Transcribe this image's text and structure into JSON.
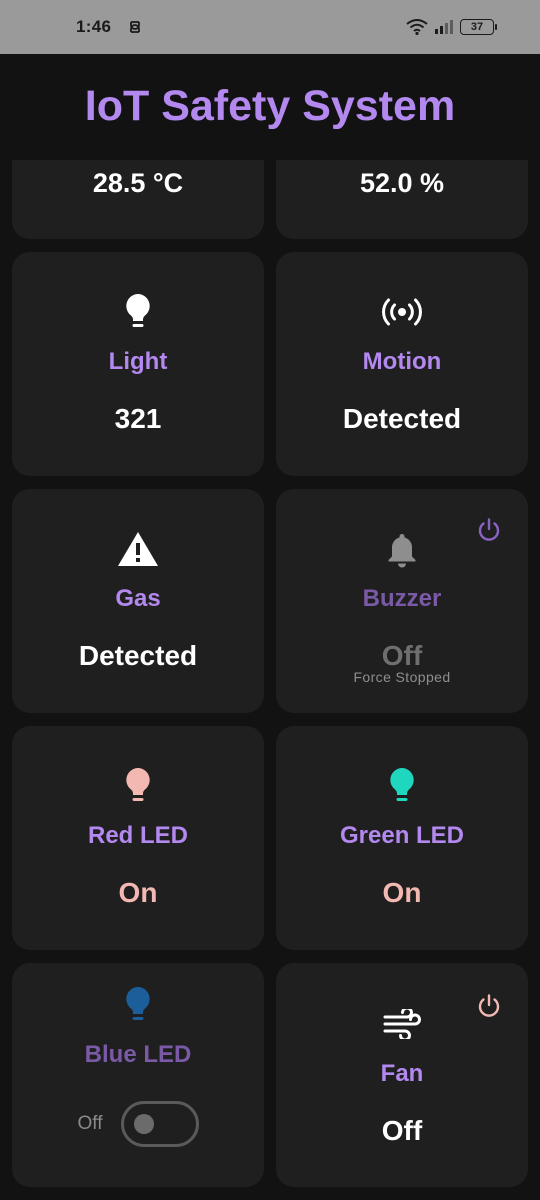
{
  "status_bar": {
    "time": "1:46",
    "battery": "37"
  },
  "app": {
    "title": "IoT Safety System"
  },
  "cards": {
    "temperature": {
      "value": "28.5 °C"
    },
    "humidity": {
      "value": "52.0 %"
    },
    "light": {
      "label": "Light",
      "value": "321",
      "icon": "lightbulb-icon"
    },
    "motion": {
      "label": "Motion",
      "value": "Detected",
      "icon": "motion-sensor-icon"
    },
    "gas": {
      "label": "Gas",
      "value": "Detected",
      "icon": "warning-icon"
    },
    "buzzer": {
      "label": "Buzzer",
      "value": "Off",
      "note": "Force Stopped",
      "icon": "bell-icon"
    },
    "red_led": {
      "label": "Red LED",
      "value": "On",
      "icon": "lightbulb-icon"
    },
    "green_led": {
      "label": "Green LED",
      "value": "On",
      "icon": "lightbulb-icon"
    },
    "blue_led": {
      "label": "Blue LED",
      "toggle_label": "Off",
      "toggle_on": false,
      "icon": "lightbulb-icon"
    },
    "fan": {
      "label": "Fan",
      "value": "Off",
      "icon": "fan-wind-icon"
    }
  },
  "colors": {
    "accent": "#b388ef",
    "accent_dim": "#7a5aa6",
    "led_on_text": "#f2b8b1",
    "red_led_icon": "#f2b8b1",
    "green_led_icon": "#1fd6bf",
    "blue_led_icon": "#1b5e99",
    "power_dim": "#8a63c2",
    "power_fan": "#f2b8b1"
  }
}
